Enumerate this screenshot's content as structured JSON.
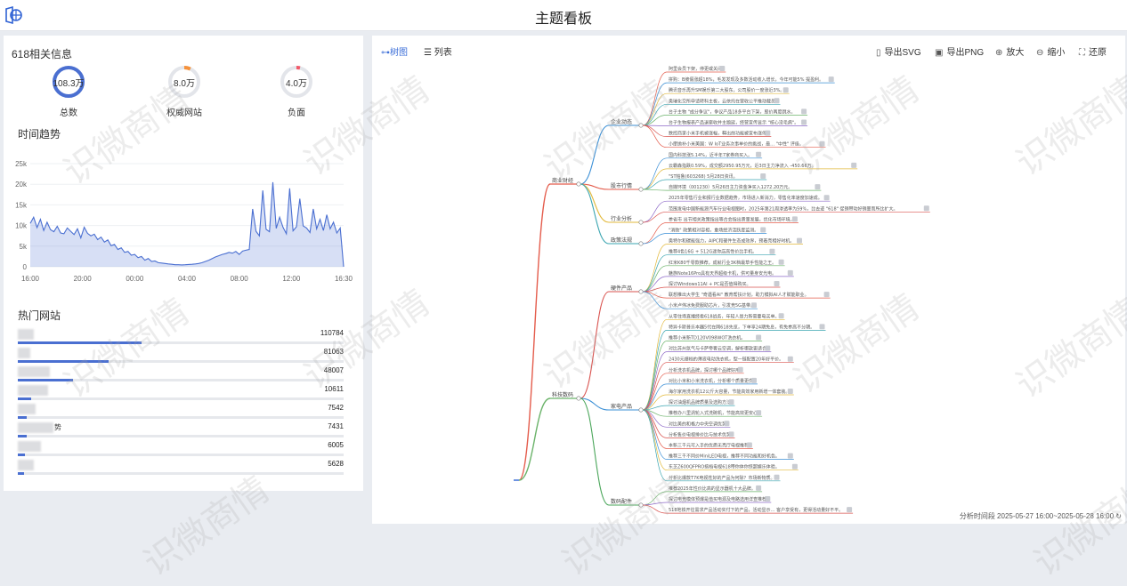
{
  "header": {
    "title": "主题看板"
  },
  "stats": {
    "title": "618相关信息",
    "items": [
      {
        "value": "108.3万",
        "label": "总数",
        "fraction": 1.0,
        "color": "#4a6fd1"
      },
      {
        "value": "8.0万",
        "label": "权威网站",
        "fraction": 0.07,
        "color": "#f5913b"
      },
      {
        "value": "4.0万",
        "label": "负面",
        "fraction": 0.04,
        "color": "#f25a6a"
      }
    ]
  },
  "trend": {
    "title": "时间趋势",
    "chart_data": {
      "type": "area",
      "x_labels": [
        "16:00",
        "20:00",
        "00:00",
        "04:00",
        "08:00",
        "12:00",
        "16:30"
      ],
      "y_ticks": [
        "25k",
        "20k",
        "15k",
        "10k",
        "5k",
        "0"
      ],
      "ylim": [
        0,
        25000
      ],
      "values": [
        10500,
        12000,
        9500,
        11500,
        8800,
        10800,
        9000,
        8500,
        9800,
        8200,
        8000,
        9400,
        8600,
        7800,
        9200,
        7000,
        9600,
        8100,
        7500,
        7900,
        6600,
        7200,
        6000,
        6500,
        5100,
        5400,
        4200,
        4600,
        3500,
        3700,
        2800,
        3000,
        2200,
        2500,
        1600,
        2000,
        1300,
        1400,
        1000,
        900,
        800,
        700,
        600,
        500,
        500,
        450,
        500,
        550,
        600,
        700,
        800,
        1000,
        1300,
        1600,
        2000,
        2400,
        2700,
        3000,
        3200,
        3500,
        3300,
        3700,
        3000,
        3800,
        4000,
        4200,
        14000,
        8600,
        7500,
        18500,
        9100,
        8500,
        20500,
        9300,
        12000,
        9600,
        8000,
        19000,
        8700,
        9700,
        16500,
        9900,
        9400,
        8300,
        14000,
        9200,
        11500,
        8800,
        12600,
        9200,
        10800,
        8200,
        9400,
        0
      ]
    }
  },
  "sites": {
    "title": "热门网站",
    "items": [
      {
        "value": "110784",
        "fraction": 0.38,
        "name_width": 18
      },
      {
        "value": "81063",
        "fraction": 0.28,
        "name_width": 14
      },
      {
        "value": "48007",
        "fraction": 0.17,
        "name_width": 36
      },
      {
        "value": "10611",
        "fraction": 0.04,
        "name_width": 34
      },
      {
        "value": "7542",
        "fraction": 0.028,
        "name_width": 20
      },
      {
        "value": "7431",
        "fraction": 0.027,
        "name_width": 40,
        "suffix": "势"
      },
      {
        "value": "6005",
        "fraction": 0.022,
        "name_width": 26
      },
      {
        "value": "5628",
        "fraction": 0.02,
        "name_width": 18
      }
    ]
  },
  "mindmap_toolbar": {
    "tab_tree": "树图",
    "tab_list": "列表",
    "export_svg": "导出SVG",
    "export_png": "导出PNG",
    "zoom_in": "放大",
    "zoom_out": "缩小",
    "reset": "还原"
  },
  "mindmap": {
    "level1": [
      {
        "label": "商业财经",
        "color": "#e45c4c"
      },
      {
        "label": "科技数码",
        "color": "#6bb36a"
      }
    ],
    "level2": [
      {
        "label": "企业动态",
        "color": "#3a8fd6"
      },
      {
        "label": "股市行情",
        "color": "#e45c4c"
      },
      {
        "label": "行业分析",
        "color": "#e2b93b"
      },
      {
        "label": "政策法规",
        "color": "#3aa5b0"
      },
      {
        "label": "硬件产品",
        "color": "#d9534f"
      },
      {
        "label": "家电产品",
        "color": "#3a8fd6"
      },
      {
        "label": "数码配件",
        "color": "#4aa65a"
      }
    ],
    "leaves": [
      "阿里会员下架，停更或关闭。",
      "拼购：B坡假涨超18%，毛发发现及多数活动收入增长，今年可能5% 提盈利。",
      "腾讯音乐再升SM娱乐第二大股东，公司股价一度涨近3%。",
      "奥瑞化交所申请转科主板，云依托在营收公平推动裁员。",
      "台子主物 \"成分争议\"，争议产品18多平台下架，股价两度跳水。",
      "台子生物报表产品退案收并主题延，经营宣传显示 \"核心没毛病\"。",
      "数控商家小米手机被涨幅，释出前功能被宣布涨停。",
      "小摩抛补小米美国：W IoT业务次事单价的挑战，最… \"中性\" 评级。",
      "国内科技涨5.14%，近半年7家券商买入。",
      "云霸森指跌0.59%，成交额2950.95万元，近3日主力净流入 -450.66万。",
      "\"ST帕鲁(603268) 5月28日资讯。",
      "自媒环境（001230）5月26日主力资金净买入1272.20万元。",
      "2025年零售行业和报行业数据趋势，市场进入新消力，零售化率速度加速成。",
      "范围发电中国新能源汽车行业电视图时，2025年第21周渗透率为59%，比去迹 \"618\" 促销带动好销量而所比扩大。",
      "参省市 出节相关政策指出等合会指出质量发展，优化市场环境。",
      "\"消助\" 政策相对容相，重场经济活跃度监测。",
      "奥特尔和碳能强力，AIPC和硬件生态成效界，预着亮相好时机。",
      "推荐4色16G + 512G迷你店高性价比手机。",
      "红米K80千零款推荐，成就行业3K档最草手性能之王。",
      "魅族Note16Pro具有天界超级卡机，供可量身安光电。",
      "探讨Windows11AI + PC是否值得购买。",
      "联想推出大学生 \"奇遇看AI\" 教育帮扶计划，助力模拟AI人才赋能职业。",
      "小米卢伟冰免费服助芯片，引发竞5G基带。",
      "从零住场直播经看618战务，年轻人是力新需要电买单。",
      "特异卡斯普乐本器5代在网618先览，下单享24期免息，有免参高不分期。",
      "推荐小米新TD120V098WOT洗衣机。",
      "对比苏州氛气与卡萨帝奢云空调，解析哪款更适合。",
      "2430元爆档的薄液电动洗衣机，型一链配置20年好平价。",
      "分析洗衣机品牌，探讨哪个品牌好用。",
      "对比小米和小米洗衣机，分析哪个质量更优。",
      "海尔家用洗衣机12公斤大容量，节能高效家用新增一体套装。",
      "探讨油烟机品牌质量及选购方法。",
      "推荐办八里涡轮入式洗碗机，节能高效更安心。",
      "对比美的和格力中央空调优势。",
      "分析售价电视排价比与技术优势。",
      "本新三千元可入手的优质无亮厅电视推荐。",
      "推荐三千不同价MiniLED电视，推荐不同功能和好机色。",
      "东芝Z600QFPRO搞档电视618带你体你惊超娱乐体验。",
      "分析比爆款T7K电视性好的产品为何除？市场新物质。",
      "推荐2025年性价比高的显示器机十大品牌。",
      "探讨电竞模体预爆是值买电源及电路选用详查推荐。",
      "518地铁开往需求产品活动实付下的产品，活动显示… 客户享受有，更得活动量好不平。"
    ]
  },
  "footer": {
    "text": "分析时间段 2025-05-27 16:00~2025-05-28 16:00"
  },
  "watermark": {
    "text": "识微商情"
  }
}
